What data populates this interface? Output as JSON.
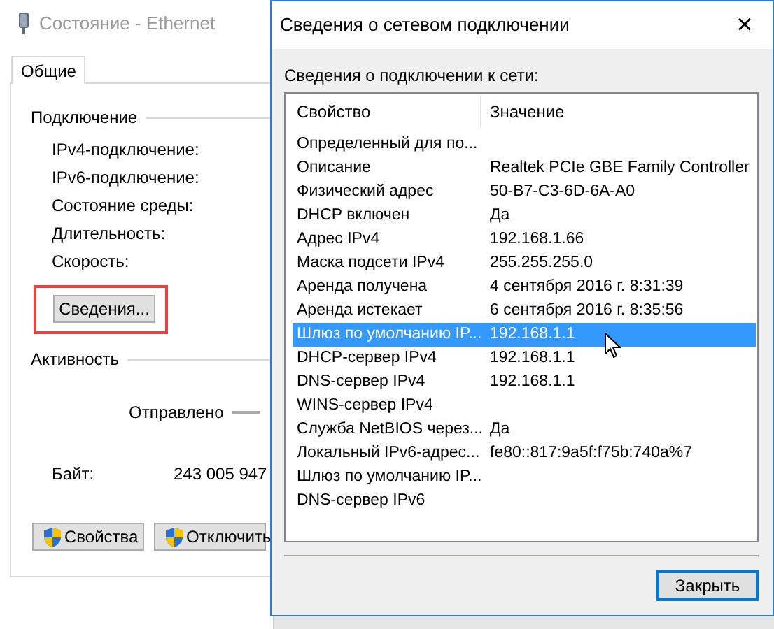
{
  "status_window": {
    "title": "Состояние - Ethernet",
    "tabs": [
      {
        "label": "Общие",
        "selected": true
      }
    ],
    "connection_heading": "Подключение",
    "connection_fields": [
      "IPv4-подключение:",
      "IPv6-подключение:",
      "Состояние среды:",
      "Длительность:",
      "Скорость:"
    ],
    "details_button": "Сведения...",
    "activity_heading": "Активность",
    "sent_label": "Отправлено",
    "bytes_label": "Байт:",
    "bytes_sent": "243 005 947",
    "buttons": [
      "Свойства",
      "Отключить"
    ]
  },
  "details_dialog": {
    "title": "Сведения о сетевом подключении",
    "close_glyph": "×",
    "list_label": "Сведения о подключении к сети:",
    "columns": [
      "Свойство",
      "Значение"
    ],
    "rows": [
      {
        "property": "Определенный для по...",
        "value": "",
        "selected": false
      },
      {
        "property": "Описание",
        "value": "Realtek PCIe GBE Family Controller",
        "selected": false
      },
      {
        "property": "Физический адрес",
        "value": "50-B7-C3-6D-6A-A0",
        "selected": false
      },
      {
        "property": "DHCP включен",
        "value": "Да",
        "selected": false
      },
      {
        "property": "Адрес IPv4",
        "value": "192.168.1.66",
        "selected": false
      },
      {
        "property": "Маска подсети IPv4",
        "value": "255.255.255.0",
        "selected": false
      },
      {
        "property": "Аренда получена",
        "value": "4 сентября 2016 г. 8:31:39",
        "selected": false
      },
      {
        "property": "Аренда истекает",
        "value": "6 сентября 2016 г. 8:35:56",
        "selected": false
      },
      {
        "property": "Шлюз по умолчанию IP...",
        "value": "192.168.1.1",
        "selected": true
      },
      {
        "property": "DHCP-сервер IPv4",
        "value": "192.168.1.1",
        "selected": false
      },
      {
        "property": "DNS-сервер IPv4",
        "value": "192.168.1.1",
        "selected": false
      },
      {
        "property": "WINS-сервер IPv4",
        "value": "",
        "selected": false
      },
      {
        "property": "Служба NetBIOS через...",
        "value": "Да",
        "selected": false
      },
      {
        "property": "Локальный IPv6-адрес...",
        "value": "fe80::817:9a5f:f75b:740a%7",
        "selected": false
      },
      {
        "property": "Шлюз по умолчанию IP...",
        "value": "",
        "selected": false
      },
      {
        "property": "DNS-сервер IPv6",
        "value": "",
        "selected": false
      }
    ],
    "close_button": "Закрыть"
  }
}
